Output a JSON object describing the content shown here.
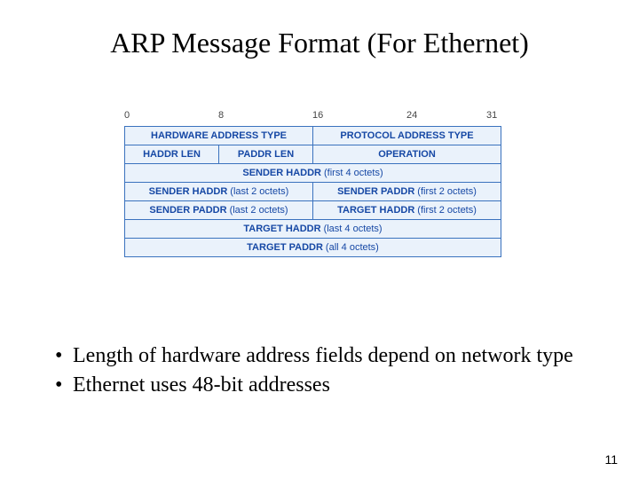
{
  "title": "ARP Message Format (For Ethernet)",
  "bit_labels": {
    "b0": "0",
    "b8": "8",
    "b16": "16",
    "b24": "24",
    "b31": "31"
  },
  "rows": {
    "r1a": "HARDWARE ADDRESS TYPE",
    "r1b": "PROTOCOL ADDRESS TYPE",
    "r2a": "HADDR LEN",
    "r2b": "PADDR LEN",
    "r2c": "OPERATION",
    "r3": {
      "bold": "SENDER HADDR",
      "rest": "(first 4 octets)"
    },
    "r4a": {
      "bold": "SENDER HADDR",
      "rest": "(last 2 octets)"
    },
    "r4b": {
      "bold": "SENDER PADDR",
      "rest": "(first 2 octets)"
    },
    "r5a": {
      "bold": "SENDER PADDR",
      "rest": "(last 2 octets)"
    },
    "r5b": {
      "bold": "TARGET HADDR",
      "rest": "(first 2 octets)"
    },
    "r6": {
      "bold": "TARGET HADDR",
      "rest": "(last 4 octets)"
    },
    "r7": {
      "bold": "TARGET PADDR",
      "rest": "(all 4 octets)"
    }
  },
  "bullets": {
    "b1": "Length of hardware address fields depend on network type",
    "b2": "Ethernet uses 48-bit addresses"
  },
  "page_number": "11"
}
